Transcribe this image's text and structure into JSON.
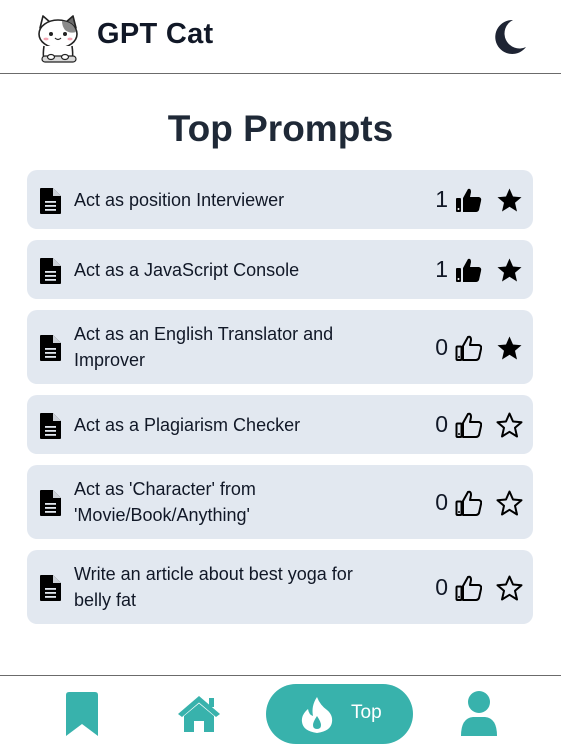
{
  "header": {
    "title": "GPT Cat",
    "logo_icon": "cat-logo",
    "theme_toggle_icon": "moon-icon"
  },
  "page": {
    "title": "Top Prompts"
  },
  "prompts": [
    {
      "text": "Act as position Interviewer",
      "votes": "1",
      "liked": true,
      "starred": true
    },
    {
      "text": "Act as a JavaScript Console",
      "votes": "1",
      "liked": true,
      "starred": true
    },
    {
      "text": "Act as an English Translator and Improver",
      "votes": "0",
      "liked": false,
      "starred": true
    },
    {
      "text": "Act as a Plagiarism Checker",
      "votes": "0",
      "liked": false,
      "starred": false
    },
    {
      "text": "Act as 'Character' from 'Movie/Book/Anything'",
      "votes": "0",
      "liked": false,
      "starred": false
    },
    {
      "text": "Write an article about best yoga for belly fat",
      "votes": "0",
      "liked": false,
      "starred": false
    }
  ],
  "bottom_nav": {
    "items": [
      {
        "icon": "bookmark-icon",
        "label": ""
      },
      {
        "icon": "home-icon",
        "label": ""
      },
      {
        "icon": "flame-icon",
        "label": "Top",
        "active": true
      },
      {
        "icon": "user-icon",
        "label": ""
      }
    ]
  },
  "colors": {
    "accent": "#38b2ac",
    "card": "#e2e8f0",
    "text": "#111827"
  }
}
